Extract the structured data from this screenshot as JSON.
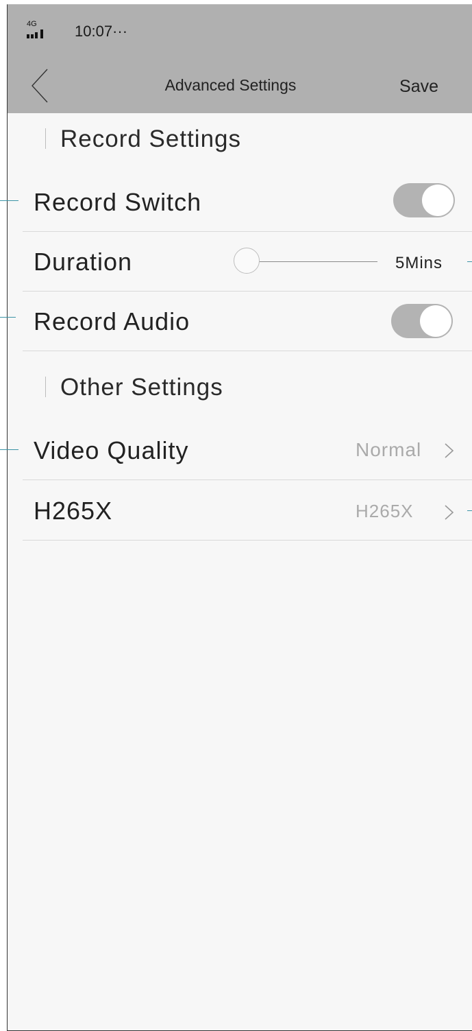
{
  "status_bar": {
    "network_label": "4G",
    "signal_icon": "signal-bars-icon",
    "time": "10:07···"
  },
  "nav": {
    "back_icon": "chevron-left-icon",
    "title": "Advanced Settings",
    "save_label": "Save"
  },
  "sections": {
    "record": {
      "title": "Record Settings",
      "record_switch": {
        "label": "Record Switch",
        "enabled": true
      },
      "duration": {
        "label": "Duration",
        "value": "5Mins",
        "slider_fraction": 0
      },
      "record_audio": {
        "label": "Record Audio",
        "enabled": true
      }
    },
    "other": {
      "title": "Other Settings",
      "video_quality": {
        "label": "Video Quality",
        "value": "Normal",
        "icon": "chevron-right-icon"
      },
      "h265x": {
        "label": "H265X",
        "value": "H265X",
        "icon": "chevron-right-icon"
      }
    }
  },
  "colors": {
    "header_bg": "#b0b0b0",
    "page_bg": "#f7f7f7",
    "toggle_on": "#b3b3b3",
    "callout_line": "#3b93a6"
  }
}
